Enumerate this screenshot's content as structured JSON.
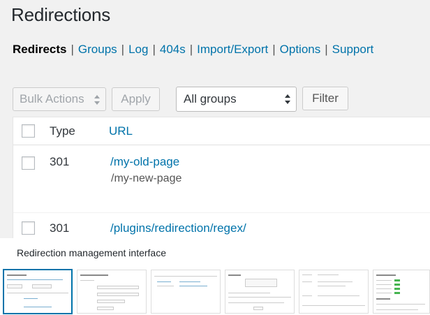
{
  "page": {
    "title": "Redirections"
  },
  "subnav": {
    "current": "Redirects",
    "links": [
      "Groups",
      "Log",
      "404s",
      "Import/Export",
      "Options",
      "Support"
    ],
    "separator": "|"
  },
  "toolbar": {
    "bulk_actions": "Bulk Actions",
    "apply": "Apply",
    "group_select": "All groups",
    "filter": "Filter"
  },
  "table": {
    "columns": {
      "type": "Type",
      "url": "URL"
    },
    "rows": [
      {
        "type": "301",
        "url": "/my-old-page",
        "target": "/my-new-page"
      },
      {
        "type": "301",
        "url": "/plugins/redirection/regex/"
      }
    ]
  },
  "caption": "Redirection management interface",
  "thumbnails": {
    "count": 6,
    "active_index": 0
  },
  "colors": {
    "link": "#0073aa",
    "background": "#f1f1f1",
    "active_border": "#0073aa"
  }
}
